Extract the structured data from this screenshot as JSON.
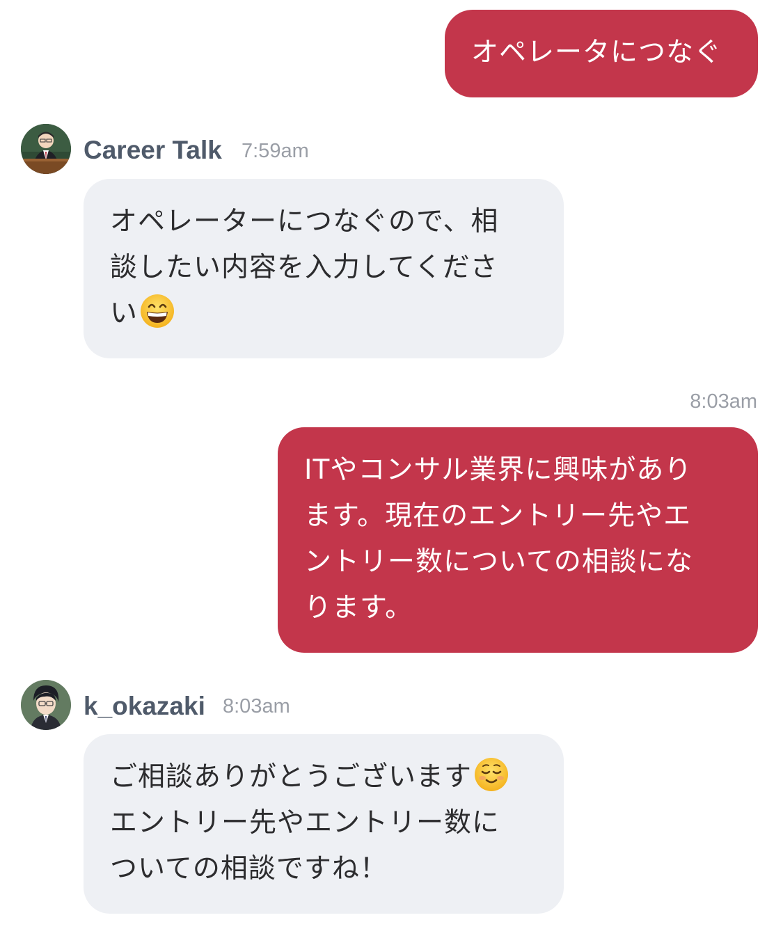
{
  "messages": [
    {
      "direction": "outgoing",
      "lines": [
        "オペレータにつなぐ"
      ]
    },
    {
      "direction": "incoming",
      "sender": "Career Talk",
      "time": "7:59am",
      "avatar_icon": "teacher-avatar-icon",
      "lines": [
        "オペレーターにつなぐので、相",
        "談したい内容を入力してくださ",
        "い"
      ],
      "emoji": "grinning-face-emoji"
    },
    {
      "direction": "outgoing",
      "time": "8:03am",
      "lines": [
        "ITやコンサル業界に興味があり",
        "ます。現在のエントリー先やエ",
        "ントリー数についての相談にな",
        "ります。"
      ]
    },
    {
      "direction": "incoming",
      "sender": "k_okazaki",
      "time": "8:03am",
      "avatar_icon": "operator-avatar-icon",
      "lines": [
        "ご相談ありがとうございます",
        "エントリー先やエントリー数に",
        "ついての相談ですね！"
      ],
      "emoji": "smiling-face-emoji"
    }
  ],
  "colors": {
    "outgoing_bubble": "#c3364b",
    "incoming_bubble": "#eef0f4",
    "sender_name": "#4f5a6a",
    "timestamp": "#9a9ea6"
  }
}
